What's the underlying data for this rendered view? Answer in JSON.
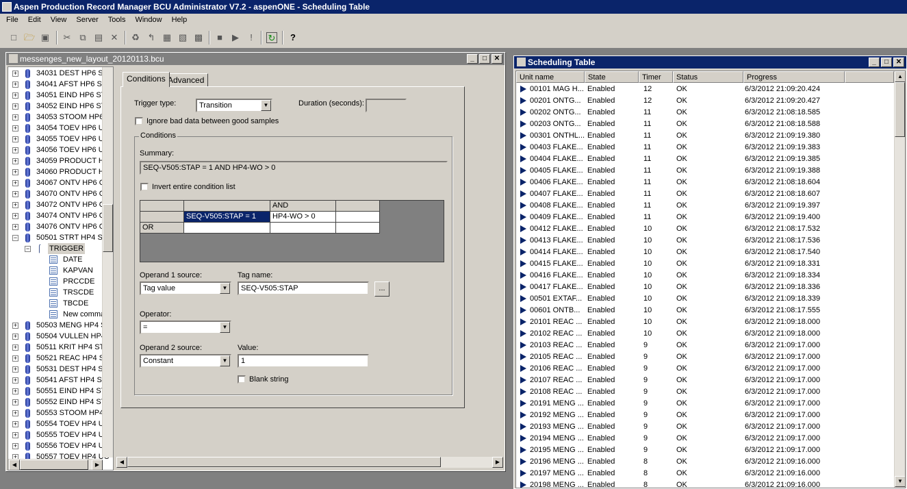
{
  "app": {
    "title": "Aspen Production Record Manager BCU Administrator V7.2 - aspenONE - Scheduling Table"
  },
  "menu": [
    "File",
    "Edit",
    "View",
    "Server",
    "Tools",
    "Window",
    "Help"
  ],
  "toolbar": [
    "new-icon",
    "open-icon",
    "save-icon",
    "cut-icon",
    "copy-icon",
    "paste-icon",
    "delete-icon",
    "add-unit-icon",
    "add-trigger-icon",
    "add-field-icon",
    "add-command-icon",
    "add-table-icon",
    "stop-icon",
    "play-icon",
    "exclamation-icon",
    "refresh-icon",
    "help-icon"
  ],
  "bcu_window": {
    "title": "messenges_new_layout_20120113.bcu"
  },
  "tree": {
    "units_top": [
      "34031 DEST HP6 ST",
      "34041 AFST HP6 ST",
      "34051 EIND HP6 ST",
      "34052 EIND HP6 ST",
      "34053 STOOM HP6",
      "34054 TOEV HP6 UC",
      "34055 TOEV HP6 UC",
      "34056 TOEV HP6 UC",
      "34059 PRODUCT HF",
      "34060 PRODUCT HF",
      "34067 ONTV HP6 O'",
      "34070 ONTV HP6 O'",
      "34072 ONTV HP6 O'",
      "34074 ONTV HP6 O'",
      "34076 ONTV HP6 O'",
      "50501 STRT HP4 ST"
    ],
    "trigger": "TRIGGER",
    "children": [
      "DATE",
      "KAPVAN",
      "PRCCDE",
      "TRSCDE",
      "TBCDE",
      "New comma"
    ],
    "units_bottom": [
      "50503 MENG HP4 ST",
      "50504 VULLEN HP4",
      "50511 KRIT HP4 STI",
      "50521 REAC HP4 ST",
      "50531 DEST HP4 ST",
      "50541 AFST HP4 ST",
      "50551 EIND HP4 ST",
      "50552 EIND HP4 ST",
      "50553 STOOM HP4",
      "50554 TOEV HP4 UC",
      "50555 TOEV HP4 UC",
      "50556 TOEV HP4 UC",
      "50557 TOEV HP4 UC"
    ]
  },
  "tabs": {
    "conditions": "Conditions",
    "advanced": "Advanced"
  },
  "form": {
    "trigger_type_label": "Trigger type:",
    "trigger_type_value": "Transition",
    "duration_label": "Duration (seconds):",
    "duration_value": "",
    "ignore_bad_label": "Ignore bad data between good samples",
    "conditions_group": "Conditions",
    "summary_label": "Summary:",
    "summary_value": "SEQ-V505:STAP = 1 AND HP4-WO > 0",
    "invert_label": "Invert entire condition list",
    "grid_and": "AND",
    "grid_or": "OR",
    "grid_c1": "SEQ-V505:STAP = 1",
    "grid_c2": "HP4-WO > 0",
    "operand1_label": "Operand 1 source:",
    "operand1_value": "Tag value",
    "tagname_label": "Tag name:",
    "tagname_value": "SEQ-V505:STAP",
    "browse_label": "...",
    "operator_label": "Operator:",
    "operator_value": "=",
    "operand2_label": "Operand 2 source:",
    "operand2_value": "Constant",
    "value_label": "Value:",
    "value_value": "1",
    "blank_label": "Blank string"
  },
  "sched": {
    "title": "Scheduling Table",
    "headers": [
      "Unit name",
      "State",
      "Timer",
      "Status",
      "Progress"
    ],
    "rows": [
      [
        "00101 MAG H...",
        "Enabled",
        "12",
        "OK",
        "6/3/2012  21:09:20.424"
      ],
      [
        "00201 ONTG...",
        "Enabled",
        "12",
        "OK",
        "6/3/2012  21:09:20.427"
      ],
      [
        "00202 ONTG...",
        "Enabled",
        "11",
        "OK",
        "6/3/2012  21:08:18.585"
      ],
      [
        "00203 ONTG...",
        "Enabled",
        "11",
        "OK",
        "6/3/2012  21:08:18.588"
      ],
      [
        "00301 ONTHL...",
        "Enabled",
        "11",
        "OK",
        "6/3/2012  21:09:19.380"
      ],
      [
        "00403 FLAKE...",
        "Enabled",
        "11",
        "OK",
        "6/3/2012  21:09:19.383"
      ],
      [
        "00404 FLAKE...",
        "Enabled",
        "11",
        "OK",
        "6/3/2012  21:09:19.385"
      ],
      [
        "00405 FLAKE...",
        "Enabled",
        "11",
        "OK",
        "6/3/2012  21:09:19.388"
      ],
      [
        "00406 FLAKE...",
        "Enabled",
        "11",
        "OK",
        "6/3/2012  21:08:18.604"
      ],
      [
        "00407 FLAKE...",
        "Enabled",
        "11",
        "OK",
        "6/3/2012  21:08:18.607"
      ],
      [
        "00408 FLAKE...",
        "Enabled",
        "11",
        "OK",
        "6/3/2012  21:09:19.397"
      ],
      [
        "00409 FLAKE...",
        "Enabled",
        "11",
        "OK",
        "6/3/2012  21:09:19.400"
      ],
      [
        "00412 FLAKE...",
        "Enabled",
        "10",
        "OK",
        "6/3/2012  21:08:17.532"
      ],
      [
        "00413 FLAKE...",
        "Enabled",
        "10",
        "OK",
        "6/3/2012  21:08:17.536"
      ],
      [
        "00414 FLAKE...",
        "Enabled",
        "10",
        "OK",
        "6/3/2012  21:08:17.540"
      ],
      [
        "00415 FLAKE...",
        "Enabled",
        "10",
        "OK",
        "6/3/2012  21:09:18.331"
      ],
      [
        "00416 FLAKE...",
        "Enabled",
        "10",
        "OK",
        "6/3/2012  21:09:18.334"
      ],
      [
        "00417 FLAKE...",
        "Enabled",
        "10",
        "OK",
        "6/3/2012  21:09:18.336"
      ],
      [
        "00501 EXTAF...",
        "Enabled",
        "10",
        "OK",
        "6/3/2012  21:09:18.339"
      ],
      [
        "00601 ONTB...",
        "Enabled",
        "10",
        "OK",
        "6/3/2012  21:08:17.555"
      ],
      [
        "20101 REAC ...",
        "Enabled",
        "10",
        "OK",
        "6/3/2012  21:09:18.000"
      ],
      [
        "20102 REAC ...",
        "Enabled",
        "10",
        "OK",
        "6/3/2012  21:09:18.000"
      ],
      [
        "20103 REAC ...",
        "Enabled",
        "9",
        "OK",
        "6/3/2012  21:09:17.000"
      ],
      [
        "20105 REAC ...",
        "Enabled",
        "9",
        "OK",
        "6/3/2012  21:09:17.000"
      ],
      [
        "20106 REAC ...",
        "Enabled",
        "9",
        "OK",
        "6/3/2012  21:09:17.000"
      ],
      [
        "20107 REAC ...",
        "Enabled",
        "9",
        "OK",
        "6/3/2012  21:09:17.000"
      ],
      [
        "20108 REAC ...",
        "Enabled",
        "9",
        "OK",
        "6/3/2012  21:09:17.000"
      ],
      [
        "20191 MENG ...",
        "Enabled",
        "9",
        "OK",
        "6/3/2012  21:09:17.000"
      ],
      [
        "20192 MENG ...",
        "Enabled",
        "9",
        "OK",
        "6/3/2012  21:09:17.000"
      ],
      [
        "20193 MENG ...",
        "Enabled",
        "9",
        "OK",
        "6/3/2012  21:09:17.000"
      ],
      [
        "20194 MENG ...",
        "Enabled",
        "9",
        "OK",
        "6/3/2012  21:09:17.000"
      ],
      [
        "20195 MENG ...",
        "Enabled",
        "9",
        "OK",
        "6/3/2012  21:09:17.000"
      ],
      [
        "20196 MENG ...",
        "Enabled",
        "8",
        "OK",
        "6/3/2012  21:09:16.000"
      ],
      [
        "20197 MENG ...",
        "Enabled",
        "8",
        "OK",
        "6/3/2012  21:09:16.000"
      ],
      [
        "20198 MENG ...",
        "Enabled",
        "8",
        "OK",
        "6/3/2012  21:09:16.000"
      ]
    ]
  }
}
